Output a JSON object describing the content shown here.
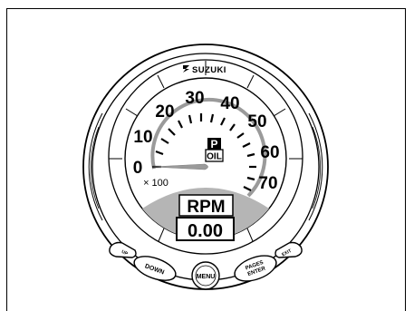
{
  "brand": "SUZUKI",
  "gauge": {
    "scale_labels": [
      "0",
      "10",
      "20",
      "30",
      "40",
      "50",
      "60",
      "70"
    ],
    "multiplier": "× 100",
    "needle_value": 0,
    "indicator": {
      "top": "P",
      "bottom": "OIL"
    },
    "display": {
      "mode_label": "RPM",
      "value": "0.00"
    }
  },
  "buttons": {
    "up": "UP",
    "down": "DOWN",
    "menu": "MENU",
    "pages_enter_line1": "PAGES",
    "pages_enter_line2": "ENTER",
    "exit": "EXIT"
  },
  "colors": {
    "display_panel": "#b5b5b5",
    "arc": "#9a9a9a",
    "needle": "#9a9a9a"
  }
}
